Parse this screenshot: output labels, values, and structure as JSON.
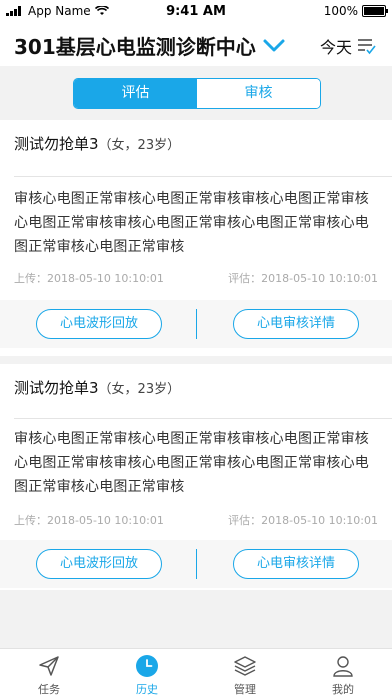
{
  "status_bar": {
    "carrier": "App Name",
    "time": "9:41 AM",
    "battery": "100%"
  },
  "header": {
    "title": "301基层心电监测诊断中心",
    "date_filter": "今天"
  },
  "segment": {
    "tabs": [
      {
        "label": "评估",
        "active": true
      },
      {
        "label": "审核",
        "active": false
      }
    ]
  },
  "cards": [
    {
      "name": "测试勿抢单3",
      "meta": "（女，23岁）",
      "content": "审核心电图正常审核心电图正常审核审核心电图正常审核心电图正常审核审核心电图正常审核心电图正常审核心电图正常审核心电图正常审核",
      "upload": "上传：2018-05-10 10:10:01",
      "assess": "评估：2018-05-10 10:10:01",
      "btn_wave": "心电波形回放",
      "btn_detail": "心电审核详情"
    },
    {
      "name": "测试勿抢单3",
      "meta": "（女，23岁）",
      "content": "审核心电图正常审核心电图正常审核审核心电图正常审核心电图正常审核审核心电图正常审核心电图正常审核心电图正常审核心电图正常审核",
      "upload": "上传：2018-05-10 10:10:01",
      "assess": "评估：2018-05-10 10:10:01",
      "btn_wave": "心电波形回放",
      "btn_detail": "心电审核详情"
    }
  ],
  "tabbar": [
    {
      "label": "任务",
      "icon": "send-icon",
      "active": false
    },
    {
      "label": "历史",
      "icon": "clock-icon",
      "active": true
    },
    {
      "label": "管理",
      "icon": "layers-icon",
      "active": false
    },
    {
      "label": "我的",
      "icon": "user-icon",
      "active": false
    }
  ],
  "colors": {
    "accent": "#1aa7e8",
    "background": "#f2f2f2"
  }
}
